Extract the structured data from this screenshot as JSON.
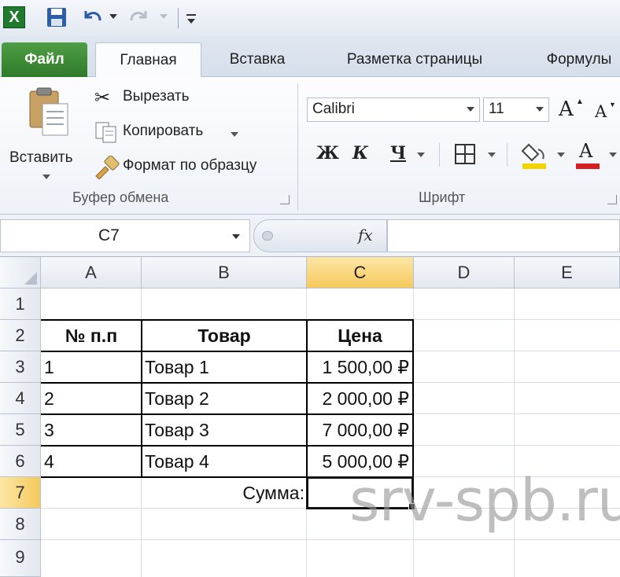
{
  "tabs": [
    "Файл",
    "Главная",
    "Вставка",
    "Разметка страницы",
    "Формулы"
  ],
  "clipboard": {
    "paste_label": "Вставить",
    "cut_label": "Вырезать",
    "copy_label": "Копировать",
    "format_painter_label": "Формат по образцу",
    "group_label": "Буфер обмена"
  },
  "font": {
    "name": "Calibri",
    "size": "11",
    "bold": "Ж",
    "italic": "К",
    "underline": "Ч",
    "grow": "A",
    "shrink": "A",
    "font_color_glyph": "A",
    "fill_color": "#f2d300",
    "font_color": "#d42020",
    "group_label": "Шрифт"
  },
  "formula_bar": {
    "name_box": "C7",
    "fx": "fx",
    "formula": ""
  },
  "sheet": {
    "columns": [
      "A",
      "B",
      "C",
      "D",
      "E"
    ],
    "rows": [
      "1",
      "2",
      "3",
      "4",
      "5",
      "6",
      "7",
      "8",
      "9"
    ],
    "header": [
      "№ п.п",
      "Товар",
      "Цена"
    ],
    "items": [
      [
        "1",
        "Товар 1",
        "1 500,00 ₽"
      ],
      [
        "2",
        "Товар 2",
        "2 000,00 ₽"
      ],
      [
        "3",
        "Товар 3",
        "7 000,00 ₽"
      ],
      [
        "4",
        "Товар 4",
        "5 000,00 ₽"
      ]
    ],
    "sum_label": "Сумма:",
    "active_cell": "C7"
  },
  "watermark": "srv-spb.ru"
}
